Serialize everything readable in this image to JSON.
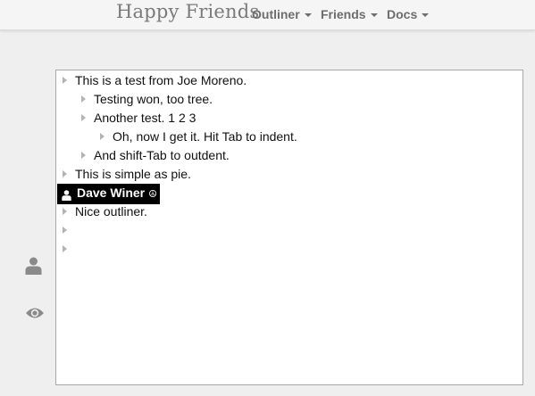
{
  "nav": {
    "brand": "Happy Friends",
    "menus": [
      {
        "label": "Outliner"
      },
      {
        "label": "Friends"
      },
      {
        "label": "Docs"
      }
    ]
  },
  "sidebar": {
    "icons": [
      "user-icon",
      "eye-icon"
    ]
  },
  "outline": {
    "nodes": [
      {
        "text": "This is a test from Joe Moreno.",
        "level": 0
      },
      {
        "text": "Testing won, too tree.",
        "level": 1
      },
      {
        "text": "Another test. 1 2 3",
        "level": 1
      },
      {
        "text": "Oh, now I get it. Hit Tab to indent.",
        "level": 2
      },
      {
        "text": "And shift-Tab to outdent.",
        "level": 1
      },
      {
        "text": "This is simple as pie.",
        "level": 0
      },
      {
        "text": "Dave Winer",
        "level": 0,
        "selected": true,
        "badge": "☮"
      },
      {
        "text": "Nice outliner.",
        "level": 0
      },
      {
        "text": "",
        "level": 0
      },
      {
        "text": "",
        "level": 0
      }
    ]
  },
  "colors": {
    "navbar_bg": "#f5f5f5",
    "page_bg": "#efefef",
    "selection_bg": "#000000",
    "selection_fg": "#ffffff"
  }
}
